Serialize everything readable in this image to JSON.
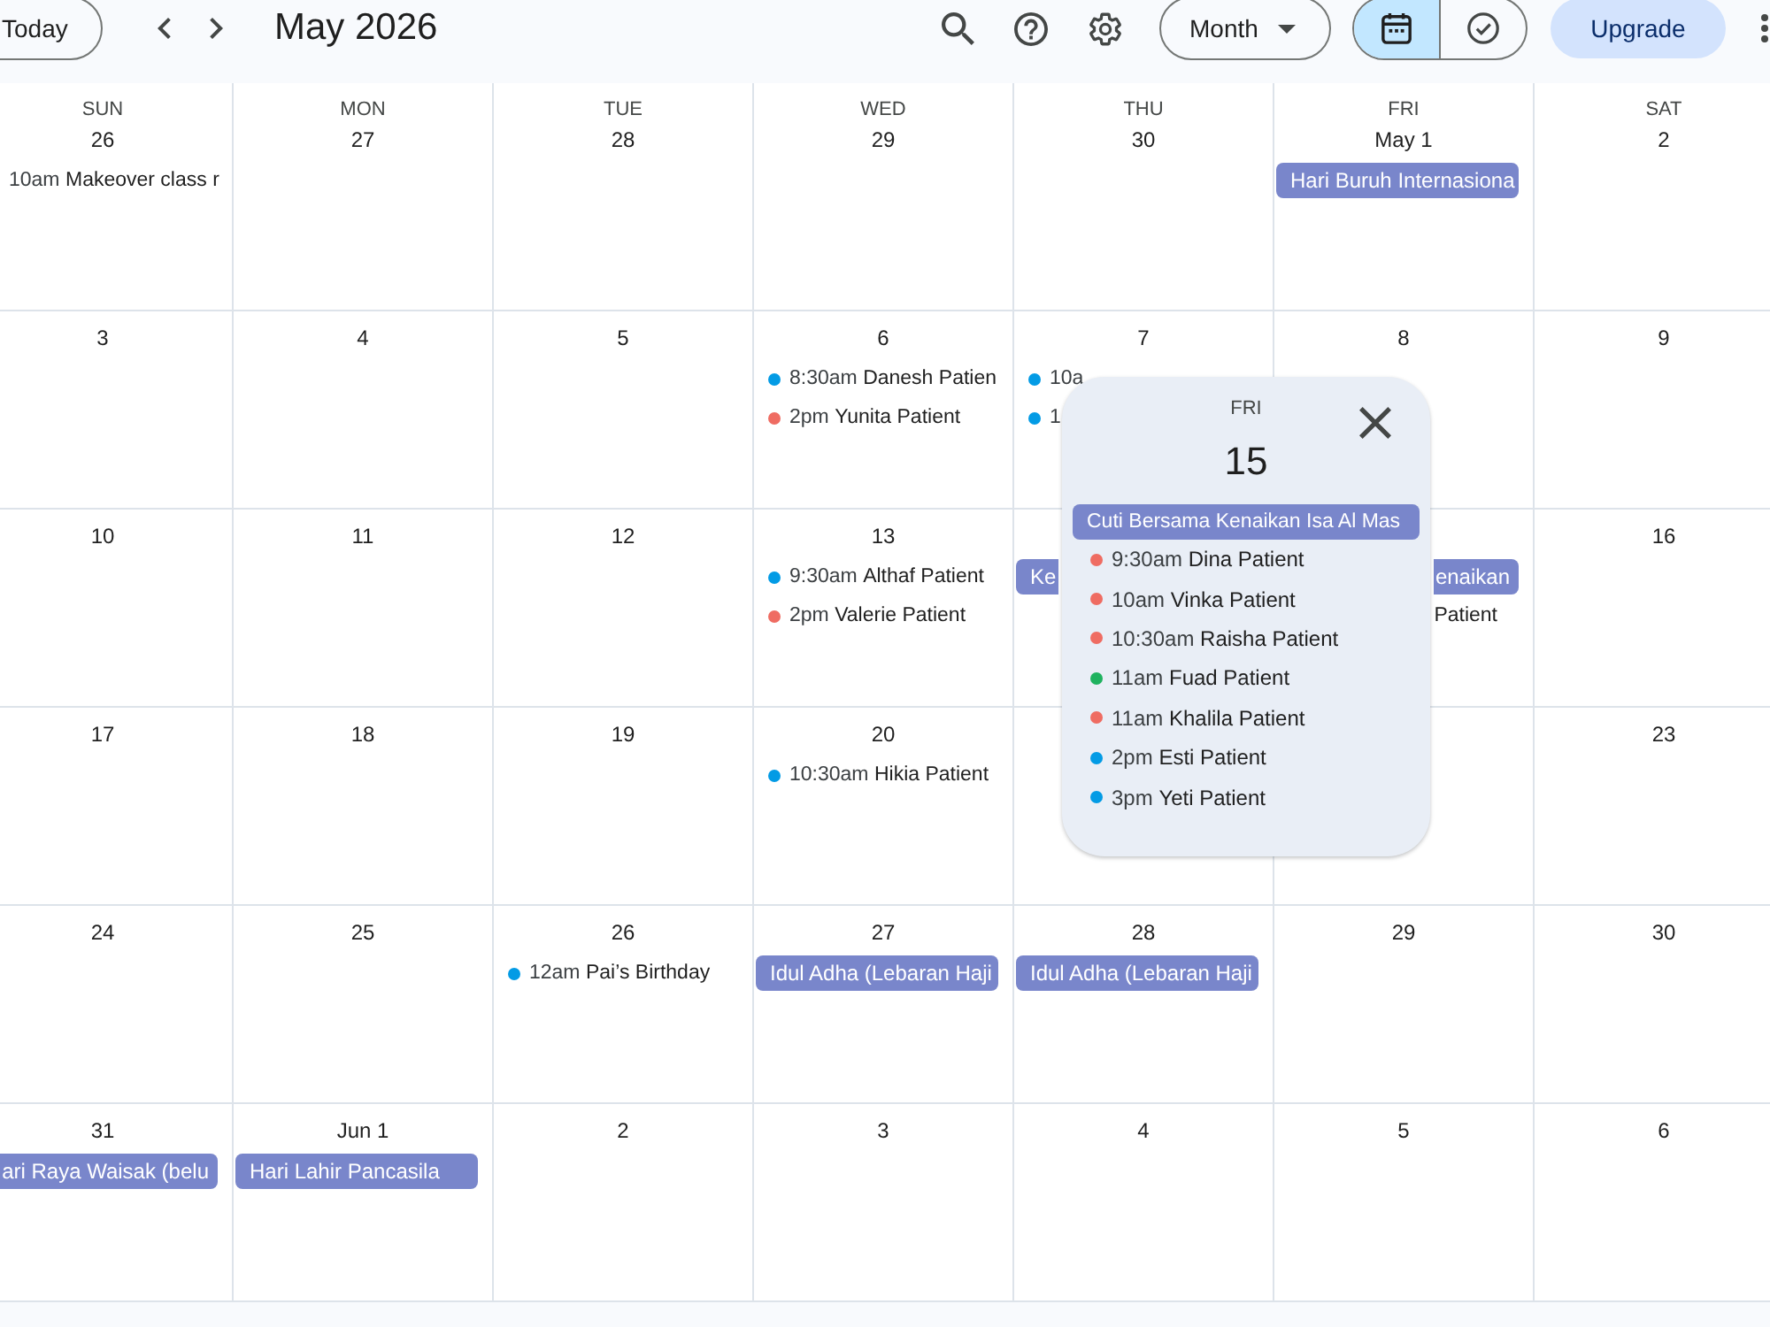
{
  "toolbar": {
    "today_button": "Today",
    "title": "May 2026",
    "view_menu": {
      "label": "Month"
    },
    "view_toggle": [
      {
        "kind": "calendar",
        "selected": true
      },
      {
        "kind": "tasks",
        "selected": false
      }
    ],
    "upgrade_button": "Upgrade"
  },
  "calendar": {
    "weekdays": [
      "SUN",
      "MON",
      "TUE",
      "WED",
      "THU",
      "FRI",
      "SAT"
    ],
    "weeks": [
      {
        "sun": {
          "date": "26",
          "events": [
            {
              "kind": "timed",
              "time": "10am",
              "title": "Makeover class r"
            }
          ]
        },
        "mon": {
          "date": "27"
        },
        "tue": {
          "date": "28"
        },
        "wed": {
          "date": "29"
        },
        "thu": {
          "date": "30"
        },
        "fri": {
          "date": "May 1",
          "events": [
            {
              "kind": "all_day",
              "title": "Hari Buruh Internasiona"
            }
          ]
        },
        "sat": {
          "date": "2"
        }
      },
      {
        "sun": {
          "date": "3"
        },
        "mon": {
          "date": "4"
        },
        "tue": {
          "date": "5"
        },
        "wed": {
          "date": "6",
          "events": [
            {
              "kind": "timed",
              "time": "8:30am",
              "title": "Danesh Patien",
              "color": "#039be5"
            },
            {
              "kind": "timed",
              "time": "2pm",
              "title": "Yunita Patient",
              "color": "#ef6c62"
            }
          ]
        },
        "thu": {
          "date": "7",
          "events": [
            {
              "kind": "timed",
              "time": "10a",
              "color": "#039be5"
            },
            {
              "kind": "timed",
              "time": "1",
              "color": "#039be5"
            }
          ]
        },
        "fri": {
          "date": "8"
        },
        "sat": {
          "date": "9"
        }
      },
      {
        "sun": {
          "date": "10"
        },
        "mon": {
          "date": "11"
        },
        "tue": {
          "date": "12"
        },
        "wed": {
          "date": "13",
          "events": [
            {
              "kind": "timed",
              "time": "9:30am",
              "title": "Althaf Patient",
              "color": "#039be5"
            },
            {
              "kind": "timed",
              "time": "2pm",
              "title": "Valerie Patient",
              "color": "#ef6c62"
            }
          ]
        },
        "thu": {
          "events": [
            {
              "kind": "all_day",
              "title": "Ke",
              "cut_right": true
            }
          ]
        },
        "fri": {
          "events": [
            {
              "kind": "all_day",
              "title": "enaikan",
              "cut_left": true
            },
            {
              "kind": "timed",
              "title": "Patient",
              "cut_left": true
            }
          ]
        },
        "sat": {
          "date": "16"
        }
      },
      {
        "sun": {
          "date": "17"
        },
        "mon": {
          "date": "18"
        },
        "tue": {
          "date": "19"
        },
        "wed": {
          "date": "20",
          "events": [
            {
              "kind": "timed",
              "time": "10:30am",
              "title": "Hikia Patient",
              "color": "#039be5"
            }
          ]
        },
        "sat": {
          "date": "23"
        }
      },
      {
        "sun": {
          "date": "24"
        },
        "mon": {
          "date": "25"
        },
        "tue": {
          "date": "26",
          "events": [
            {
              "kind": "timed",
              "time": "12am",
              "title": "Pai’s Birthday",
              "color": "#039be5"
            }
          ]
        },
        "wed": {
          "date": "27",
          "events": [
            {
              "kind": "all_day",
              "title": "Idul Adha (Lebaran Haji"
            }
          ]
        },
        "thu": {
          "date": "28",
          "events": [
            {
              "kind": "all_day",
              "title": "Idul Adha (Lebaran Haji"
            }
          ]
        },
        "fri": {
          "date": "29"
        },
        "sat": {
          "date": "30"
        }
      },
      {
        "sun": {
          "date": "31",
          "events": [
            {
              "kind": "all_day",
              "title": "ari Raya Waisak (belu",
              "cut_left": true
            }
          ]
        },
        "mon": {
          "date": "Jun 1",
          "events": [
            {
              "kind": "all_day",
              "title": "Hari Lahir Pancasila"
            }
          ]
        },
        "tue": {
          "date": "2"
        },
        "wed": {
          "date": "3"
        },
        "thu": {
          "date": "4"
        },
        "fri": {
          "date": "5"
        },
        "sat": {
          "date": "6"
        }
      }
    ]
  },
  "popup": {
    "weekday": "FRI",
    "date": "15",
    "events": [
      {
        "kind": "all_day",
        "title": "Cuti Bersama Kenaikan Isa Al Mas"
      },
      {
        "kind": "timed",
        "time": "9:30am",
        "title": "Dina Patient",
        "color": "#ef6c62"
      },
      {
        "kind": "timed",
        "time": "10am",
        "title": "Vinka Patient",
        "color": "#ef6c62"
      },
      {
        "kind": "timed",
        "time": "10:30am",
        "title": "Raisha Patient",
        "color": "#ef6c62"
      },
      {
        "kind": "timed",
        "time": "11am",
        "title": "Fuad Patient",
        "color": "#1fb25f"
      },
      {
        "kind": "timed",
        "time": "11am",
        "title": "Khalila Patient",
        "color": "#ef6c62"
      },
      {
        "kind": "timed",
        "time": "2pm",
        "title": "Esti Patient",
        "color": "#039be5"
      },
      {
        "kind": "timed",
        "time": "3pm",
        "title": "Yeti Patient",
        "color": "#039be5"
      }
    ]
  }
}
